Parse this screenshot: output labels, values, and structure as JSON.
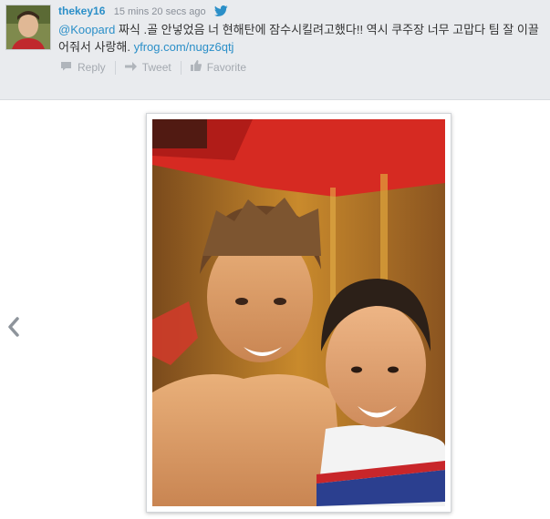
{
  "tweet": {
    "username": "thekey16",
    "timestamp": "15 mins 20 secs ago",
    "mention": "@Koopard",
    "body": " 짜식 .골 안넣었음 너 현해탄에 잠수시킬려고했다!! 역시 쿠주장 너무 고맙다 팀 잘 이끌어줘서 사랑해. ",
    "link": "yfrog.com/nugz6qtj"
  },
  "actions": {
    "reply_label": "Reply",
    "retweet_label": "Tweet",
    "favorite_label": "Favorite"
  },
  "colors": {
    "accent": "#2b8fc8",
    "bar_background": "#e9ebee",
    "muted": "#a4a9b0"
  },
  "icons": {
    "twitter": "twitter-bird-icon",
    "reply": "reply-icon",
    "retweet": "retweet-icon",
    "favorite": "favorite-icon",
    "previous": "chevron-left-icon"
  }
}
